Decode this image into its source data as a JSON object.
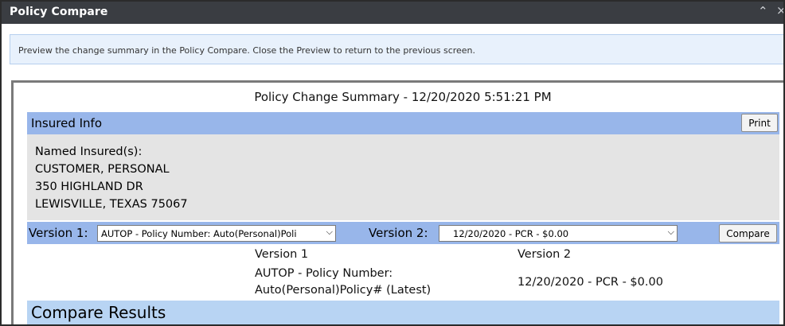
{
  "window": {
    "title": "Policy Compare",
    "collapse_glyph": "⌃",
    "close_glyph": "×"
  },
  "info_banner": {
    "text": "Preview the change summary in the Policy Compare. Close the Preview to return to the previous screen."
  },
  "summary": {
    "title": "Policy Change Summary - 12/20/2020 5:51:21 PM"
  },
  "insured_info": {
    "header": "Insured Info",
    "print_label": "Print",
    "lines": [
      "Named Insured(s):",
      "CUSTOMER, PERSONAL",
      "350 HIGHLAND DR",
      "LEWISVILLE, TEXAS 75067"
    ]
  },
  "versions": {
    "version1_label": "Version 1:",
    "version1_selected": "AUTOP - Policy Number: Auto(Personal)Poli",
    "version2_label": "Version 2:",
    "version2_selected": "12/20/2020 - PCR - $0.00",
    "compare_label": "Compare"
  },
  "comparison": {
    "col1_header": "Version 1",
    "col2_header": "Version 2",
    "col1_value_line1": "AUTOP - Policy Number:",
    "col1_value_line2": "Auto(Personal)Policy# (Latest)",
    "col2_value": "12/20/2020 - PCR - $0.00"
  },
  "results": {
    "header": "Compare Results"
  },
  "icons": {
    "collapse": "chevron-up-icon",
    "close": "close-icon",
    "dropdown": "chevron-down-icon"
  },
  "colors": {
    "titlebar": "#3a3d42",
    "banner_bg": "#e8f1fc",
    "section_bar": "#98b6ea",
    "insured_bg": "#e4e4e4",
    "results_bar": "#b8d4f3"
  }
}
